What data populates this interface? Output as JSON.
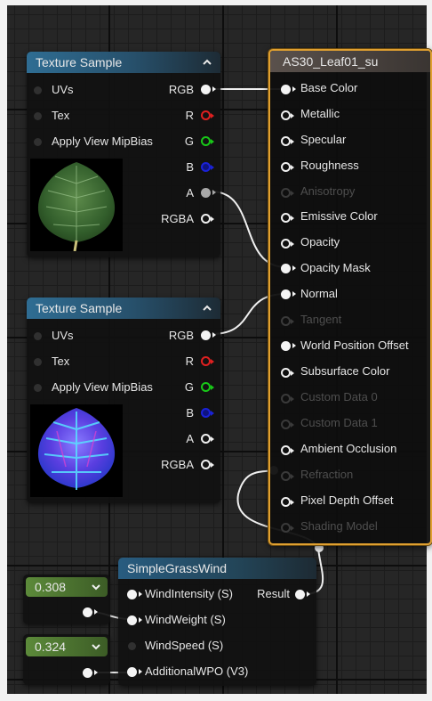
{
  "texture_node_1": {
    "title": "Texture Sample",
    "inputs": [
      "UVs",
      "Tex",
      "Apply View MipBias"
    ],
    "outputs": [
      "RGB",
      "R",
      "G",
      "B",
      "A",
      "RGBA"
    ]
  },
  "texture_node_2": {
    "title": "Texture Sample",
    "inputs": [
      "UVs",
      "Tex",
      "Apply View MipBias"
    ],
    "outputs": [
      "RGB",
      "R",
      "G",
      "B",
      "A",
      "RGBA"
    ]
  },
  "material_node": {
    "title": "AS30_Leaf01_su",
    "inputs": [
      "Base Color",
      "Metallic",
      "Specular",
      "Roughness",
      "Anisotropy",
      "Emissive Color",
      "Opacity",
      "Opacity Mask",
      "Normal",
      "Tangent",
      "World Position Offset",
      "Subsurface Color",
      "Custom Data 0",
      "Custom Data 1",
      "Ambient Occlusion",
      "Refraction",
      "Pixel Depth Offset",
      "Shading Model"
    ]
  },
  "function_node": {
    "title": "SimpleGrassWind",
    "inputs": [
      "WindIntensity (S)",
      "WindWeight (S)",
      "WindSpeed (S)",
      "AdditionalWPO (V3)"
    ],
    "output": "Result"
  },
  "constant_1": {
    "value": "0.308"
  },
  "constant_2": {
    "value": "0.324"
  },
  "colors": {
    "material_border": "#e0a030",
    "texture_header": "#2f6d93",
    "constant_header": "#5c8a3a",
    "pin_red": "#e02020",
    "pin_green": "#18c818",
    "pin_blue": "#1a22d8"
  },
  "icons": {
    "collapse": "chevron-up-icon",
    "constant_expand": "chevron-down-icon",
    "preview_1": "green-leaf-texture",
    "preview_2": "blue-normal-map-leaf-texture"
  }
}
